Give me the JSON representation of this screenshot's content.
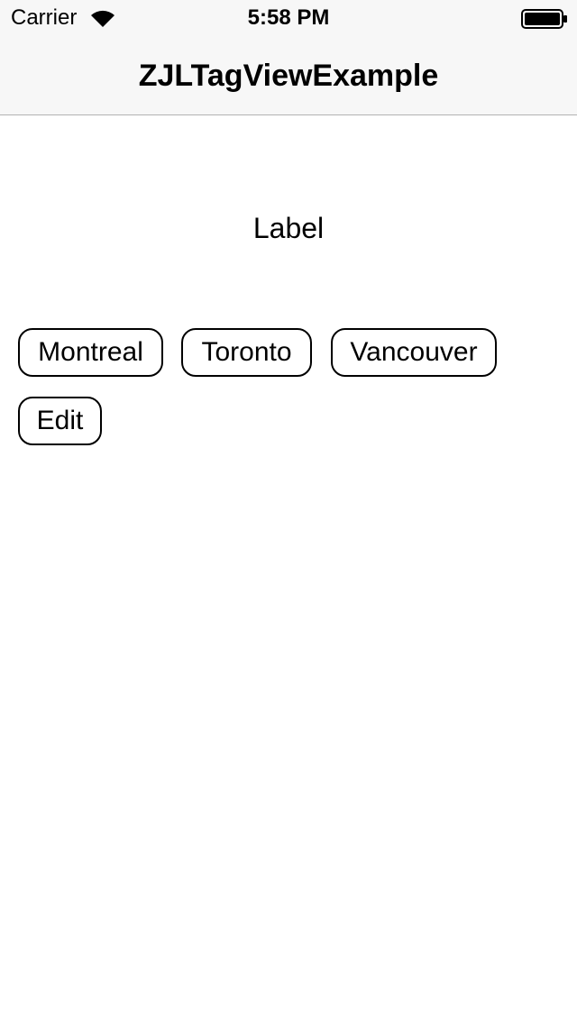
{
  "status_bar": {
    "carrier": "Carrier",
    "time": "5:58 PM",
    "wifi_icon": "wifi-icon",
    "battery_icon": "battery-icon"
  },
  "nav": {
    "title": "ZJLTagViewExample"
  },
  "content": {
    "label": "Label",
    "tags": [
      "Montreal",
      "Toronto",
      "Vancouver",
      "Edit"
    ]
  }
}
